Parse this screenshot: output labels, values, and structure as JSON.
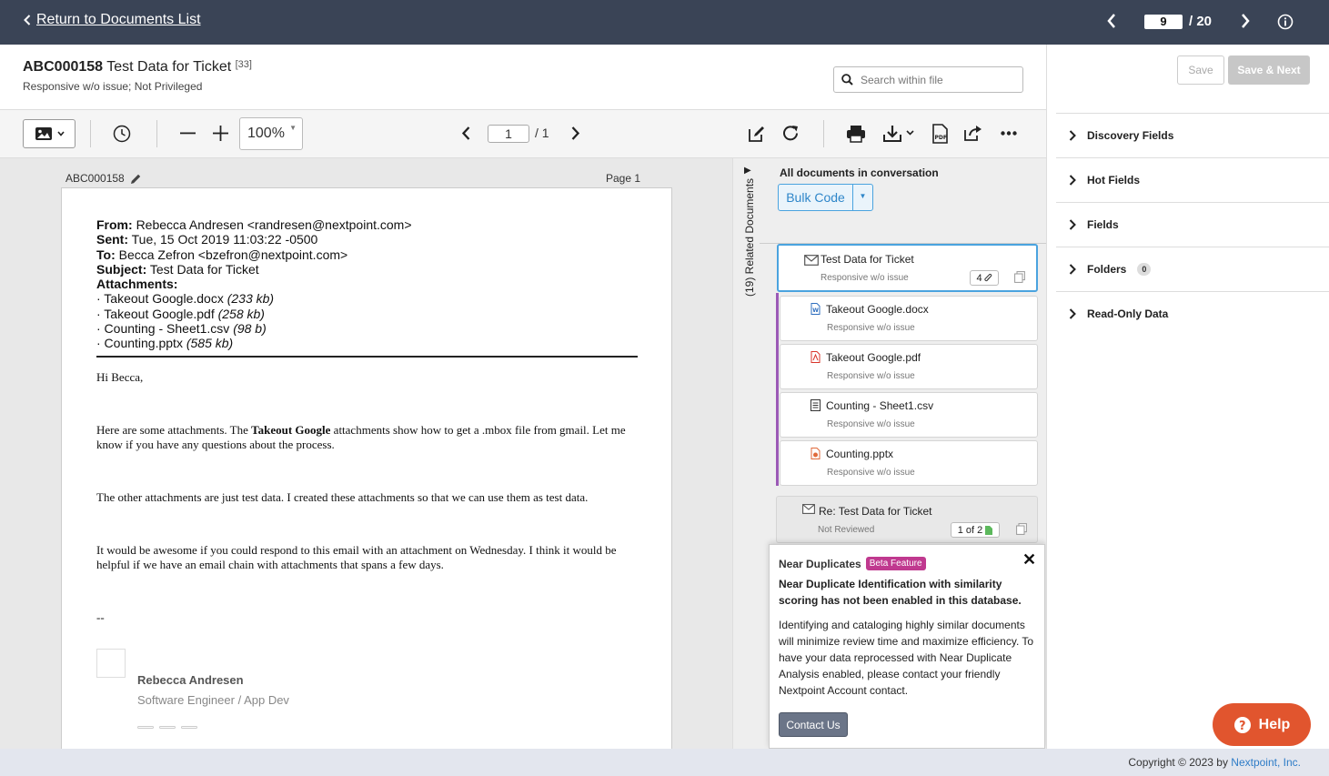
{
  "topbar": {
    "back_label": "Return to Documents List",
    "current_doc": "9",
    "total_docs": "/ 20"
  },
  "header": {
    "doc_id": "ABC000158",
    "doc_title": "Test Data for Ticket",
    "doc_count": "[33]",
    "subtitle": "Responsive w/o issue; Not Privileged",
    "search_placeholder": "Search within file"
  },
  "toolbar": {
    "zoom": "100%",
    "page_current": "1",
    "page_total": "/ 1"
  },
  "viewer": {
    "doc_id": "ABC000158",
    "page_label": "Page 1",
    "email": {
      "from_label": "From:",
      "from_value": "Rebecca Andresen <randresen@nextpoint.com>",
      "sent_label": "Sent:",
      "sent_value": "Tue, 15 Oct 2019 11:03:22 -0500",
      "to_label": "To:",
      "to_value": "Becca Zefron <bzefron@nextpoint.com>",
      "subject_label": "Subject:",
      "subject_value": "Test Data for Ticket",
      "attachments_label": "Attachments:",
      "attachments": [
        {
          "name": "· Takeout Google.docx",
          "size": "(233 kb)"
        },
        {
          "name": "· Takeout Google.pdf",
          "size": "(258 kb)"
        },
        {
          "name": "· Counting - Sheet1.csv",
          "size": "(98 b)"
        },
        {
          "name": "· Counting.pptx",
          "size": "(585 kb)"
        }
      ],
      "greeting": "Hi Becca,",
      "p1_pre": "Here are some attachments. The ",
      "p1_bold": "Takeout Google",
      "p1_post": " attachments show how to get a .mbox file from gmail. Let me know if you have any questions about the process.",
      "p2": "The other attachments are just test data. I created these attachments so that we can use them as test data.",
      "p3": "It would be awesome if you could respond to this email with an attachment on Wednesday. I think it would be helpful if we have an email chain with attachments that spans a few days.",
      "signoff": "--",
      "sig_name": "Rebecca Andresen",
      "sig_role": "Software Engineer / App Dev"
    }
  },
  "related": {
    "tab_label": "(19) Related Documents",
    "title": "All documents in conversation",
    "bulk_code": "Bulk Code",
    "items": [
      {
        "title": "Test Data for Ticket",
        "status": "Responsive w/o issue",
        "badge": "4",
        "icon": "email-icon"
      },
      {
        "title": "Takeout Google.docx",
        "status": "Responsive w/o issue",
        "icon": "word-file-icon"
      },
      {
        "title": "Takeout Google.pdf",
        "status": "Responsive w/o issue",
        "icon": "pdf-file-icon"
      },
      {
        "title": "Counting - Sheet1.csv",
        "status": "Responsive w/o issue",
        "icon": "text-file-icon"
      },
      {
        "title": "Counting.pptx",
        "status": "Responsive w/o issue",
        "icon": "ppt-file-icon"
      },
      {
        "title": "Re: Test Data for Ticket",
        "status": "Not Reviewed",
        "badge": "1 of 2",
        "icon": "email-icon"
      }
    ]
  },
  "near_duplicates": {
    "title": "Near Duplicates",
    "beta": "Beta Feature",
    "bold_text": "Near Duplicate Identification with similarity scoring has not been enabled in this database.",
    "body_text": "Identifying and cataloging highly similar documents will minimize review time and maximize efficiency. To have your data reprocessed with Near Duplicate Analysis enabled, please contact your friendly Nextpoint Account contact.",
    "contact_button": "Contact Us"
  },
  "right_panel": {
    "save": "Save",
    "save_next": "Save & Next",
    "sections": [
      {
        "label": "Discovery Fields"
      },
      {
        "label": "Hot Fields"
      },
      {
        "label": "Fields"
      },
      {
        "label": "Folders",
        "badge": "0"
      },
      {
        "label": "Read-Only Data"
      }
    ]
  },
  "footer": {
    "copyright": "Copyright © 2023 by ",
    "company": "Nextpoint, Inc."
  },
  "help": {
    "label": "Help"
  },
  "colors": {
    "topbar": "#3a4456",
    "accent_blue": "#2e86c9",
    "active_card_border": "#4aa3df",
    "attachment_bar": "#9b59b6",
    "beta_badge": "#c0398f",
    "help_button": "#e1552e"
  }
}
